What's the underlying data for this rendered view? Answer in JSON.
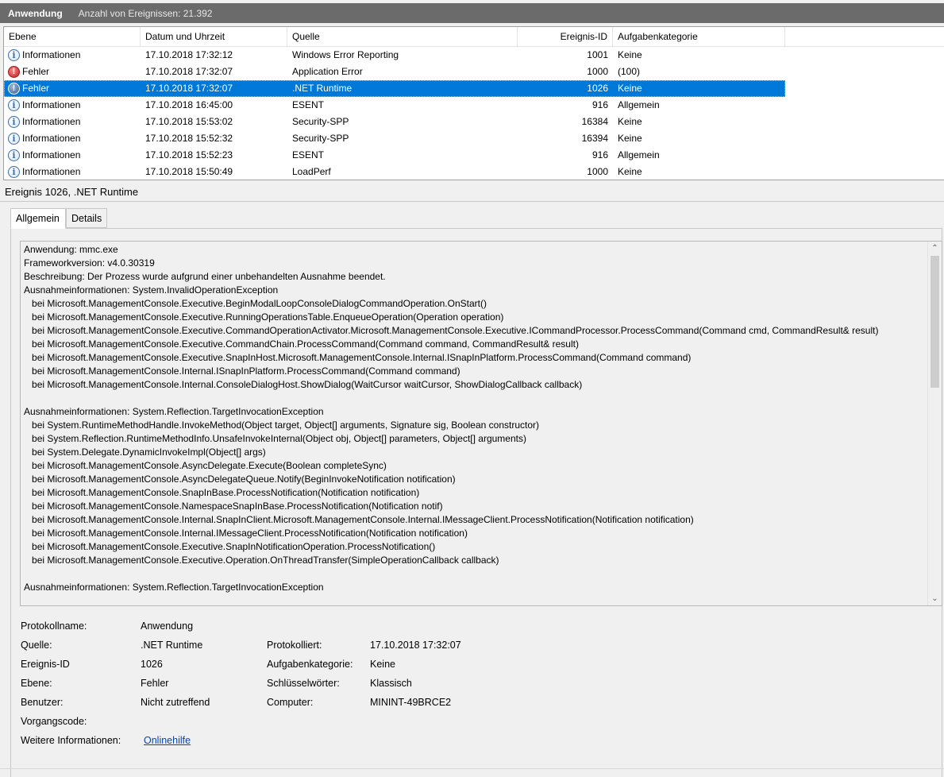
{
  "header": {
    "log_name": "Anwendung",
    "event_count": "Anzahl von Ereignissen: 21.392"
  },
  "grid": {
    "columns": [
      "Ebene",
      "Datum und Uhrzeit",
      "Quelle",
      "Ereignis-ID",
      "Aufgabenkategorie"
    ],
    "rows": [
      {
        "level": "Informationen",
        "icon": "info-icon",
        "datetime": "17.10.2018 17:32:12",
        "source": "Windows Error Reporting",
        "id": "1001",
        "category": "Keine"
      },
      {
        "level": "Fehler",
        "icon": "error-icon",
        "datetime": "17.10.2018 17:32:07",
        "source": "Application Error",
        "id": "1000",
        "category": "(100)"
      },
      {
        "level": "Fehler",
        "icon": "error-icon",
        "datetime": "17.10.2018 17:32:07",
        "source": ".NET Runtime",
        "id": "1026",
        "category": "Keine",
        "selected": true
      },
      {
        "level": "Informationen",
        "icon": "info-icon",
        "datetime": "17.10.2018 16:45:00",
        "source": "ESENT",
        "id": "916",
        "category": "Allgemein"
      },
      {
        "level": "Informationen",
        "icon": "info-icon",
        "datetime": "17.10.2018 15:53:02",
        "source": "Security-SPP",
        "id": "16384",
        "category": "Keine"
      },
      {
        "level": "Informationen",
        "icon": "info-icon",
        "datetime": "17.10.2018 15:52:32",
        "source": "Security-SPP",
        "id": "16394",
        "category": "Keine"
      },
      {
        "level": "Informationen",
        "icon": "info-icon",
        "datetime": "17.10.2018 15:52:23",
        "source": "ESENT",
        "id": "916",
        "category": "Allgemein"
      },
      {
        "level": "Informationen",
        "icon": "info-icon",
        "datetime": "17.10.2018 15:50:49",
        "source": "LoadPerf",
        "id": "1000",
        "category": "Keine"
      }
    ]
  },
  "detail": {
    "title": "Ereignis 1026, .NET Runtime",
    "tabs": [
      "Allgemein",
      "Details"
    ],
    "description": "Anwendung: mmc.exe\nFrameworkversion: v4.0.30319\nBeschreibung: Der Prozess wurde aufgrund einer unbehandelten Ausnahme beendet.\nAusnahmeinformationen: System.InvalidOperationException\n   bei Microsoft.ManagementConsole.Executive.BeginModalLoopConsoleDialogCommandOperation.OnStart()\n   bei Microsoft.ManagementConsole.Executive.RunningOperationsTable.EnqueueOperation(Operation operation)\n   bei Microsoft.ManagementConsole.Executive.CommandOperationActivator.Microsoft.ManagementConsole.Executive.ICommandProcessor.ProcessCommand(Command cmd, CommandResult& result)\n   bei Microsoft.ManagementConsole.Executive.CommandChain.ProcessCommand(Command command, CommandResult& result)\n   bei Microsoft.ManagementConsole.Executive.SnapInHost.Microsoft.ManagementConsole.Internal.ISnapInPlatform.ProcessCommand(Command command)\n   bei Microsoft.ManagementConsole.Internal.ISnapInPlatform.ProcessCommand(Command command)\n   bei Microsoft.ManagementConsole.Internal.ConsoleDialogHost.ShowDialog(WaitCursor waitCursor, ShowDialogCallback callback)\n\nAusnahmeinformationen: System.Reflection.TargetInvocationException\n   bei System.RuntimeMethodHandle.InvokeMethod(Object target, Object[] arguments, Signature sig, Boolean constructor)\n   bei System.Reflection.RuntimeMethodInfo.UnsafeInvokeInternal(Object obj, Object[] parameters, Object[] arguments)\n   bei System.Delegate.DynamicInvokeImpl(Object[] args)\n   bei Microsoft.ManagementConsole.AsyncDelegate.Execute(Boolean completeSync)\n   bei Microsoft.ManagementConsole.AsyncDelegateQueue.Notify(BeginInvokeNotification notification)\n   bei Microsoft.ManagementConsole.SnapInBase.ProcessNotification(Notification notification)\n   bei Microsoft.ManagementConsole.NamespaceSnapInBase.ProcessNotification(Notification notif)\n   bei Microsoft.ManagementConsole.Internal.SnapInClient.Microsoft.ManagementConsole.Internal.IMessageClient.ProcessNotification(Notification notification)\n   bei Microsoft.ManagementConsole.Internal.IMessageClient.ProcessNotification(Notification notification)\n   bei Microsoft.ManagementConsole.Executive.SnapInNotificationOperation.ProcessNotification()\n   bei Microsoft.ManagementConsole.Executive.Operation.OnThreadTransfer(SimpleOperationCallback callback)\n\nAusnahmeinformationen: System.Reflection.TargetInvocationException",
    "props": {
      "protokollname_label": "Protokollname:",
      "protokollname": "Anwendung",
      "quelle_label": "Quelle:",
      "quelle": ".NET Runtime",
      "protokolliert_label": "Protokolliert:",
      "protokolliert": "17.10.2018 17:32:07",
      "ereignisid_label": "Ereignis-ID",
      "ereignisid": "1026",
      "aufgabenkategorie_label": "Aufgabenkategorie:",
      "aufgabenkategorie": "Keine",
      "ebene_label": "Ebene:",
      "ebene": "Fehler",
      "schluesselwoerter_label": "Schlüsselwörter:",
      "schluesselwoerter": "Klassisch",
      "benutzer_label": "Benutzer:",
      "benutzer": "Nicht zutreffend",
      "computer_label": "Computer:",
      "computer": "MININT-49BRCE2",
      "vorgangscode_label": "Vorgangscode:",
      "weitere_label": "Weitere Informationen:",
      "weitere_link": "Onlinehilfe"
    }
  }
}
